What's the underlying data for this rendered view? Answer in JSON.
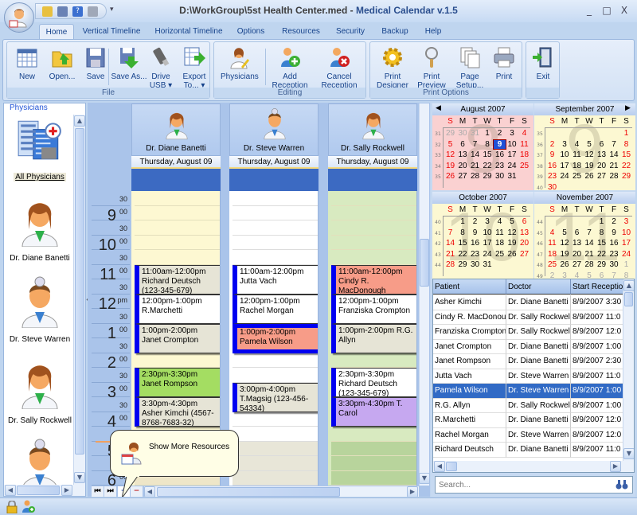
{
  "window": {
    "title_path": "D:\\WorkGroup\\5st Health Center.med",
    "title_sep": " - ",
    "title_app": "Medical Calendar v.1.5",
    "minimize": "_",
    "maximize": "□",
    "close": "X"
  },
  "quick_access": [
    "open-icon",
    "save-icon",
    "help-icon",
    "print-icon"
  ],
  "tabs": [
    {
      "label": "Home",
      "active": true
    },
    {
      "label": "Vertical Timeline"
    },
    {
      "label": "Horizontal Timeline"
    },
    {
      "label": "Options"
    },
    {
      "label": "Resources"
    },
    {
      "label": "Security"
    },
    {
      "label": "Backup"
    },
    {
      "label": "Help"
    }
  ],
  "ribbon": {
    "groups": [
      {
        "label": "File",
        "buttons": [
          {
            "label": "New",
            "icon": "calendar-grid-icon"
          },
          {
            "label": "Open...",
            "icon": "folder-open-icon"
          },
          {
            "label": "Save",
            "icon": "floppy-icon"
          },
          {
            "label": "Save As...",
            "icon": "save-as-icon"
          },
          {
            "label": "Drive USB ▾",
            "icon": "usb-drive-icon"
          },
          {
            "label": "Export To... ▾",
            "icon": "export-icon"
          }
        ]
      },
      {
        "label": "Editing",
        "buttons": [
          {
            "label": "Physicians",
            "icon": "physician-icon"
          },
          {
            "label": "Add Reception",
            "icon": "add-reception-icon"
          },
          {
            "label": "Cancel Reception ▾",
            "icon": "cancel-reception-icon"
          }
        ]
      },
      {
        "label": "Print Options",
        "buttons": [
          {
            "label": "Print Designer",
            "icon": "gear-icon"
          },
          {
            "label": "Print Preview",
            "icon": "magnifier-icon"
          },
          {
            "label": "Page Setup...",
            "icon": "pages-icon"
          },
          {
            "label": "Print",
            "icon": "printer-icon"
          }
        ]
      },
      {
        "label": "",
        "buttons": [
          {
            "label": "Exit",
            "icon": "exit-door-icon"
          }
        ]
      }
    ]
  },
  "physicians_panel": {
    "title": "Physicians",
    "items": [
      {
        "label": "All Physicians",
        "icon": "hospital-icon"
      },
      {
        "label": "Dr. Diane Banetti",
        "icon": "female-doctor-icon"
      },
      {
        "label": "Dr. Steve Warren",
        "icon": "male-doctor-icon"
      },
      {
        "label": "Dr. Sally Rockwell",
        "icon": "female-doctor-icon"
      },
      {
        "label": "",
        "icon": "male-doctor-icon"
      }
    ]
  },
  "schedule": {
    "time_labels": [
      {
        "h": "",
        "m": "30"
      },
      {
        "h": "9",
        "m": "00"
      },
      {
        "h": "",
        "m": "30"
      },
      {
        "h": "10",
        "m": "00"
      },
      {
        "h": "",
        "m": "30"
      },
      {
        "h": "11",
        "m": "00"
      },
      {
        "h": "",
        "m": "30"
      },
      {
        "h": "12",
        "m": "pm"
      },
      {
        "h": "",
        "m": "30"
      },
      {
        "h": "1",
        "m": "00"
      },
      {
        "h": "",
        "m": "30"
      },
      {
        "h": "2",
        "m": "00"
      },
      {
        "h": "",
        "m": "30"
      },
      {
        "h": "3",
        "m": "00"
      },
      {
        "h": "",
        "m": "30"
      },
      {
        "h": "4",
        "m": "00"
      },
      {
        "h": "",
        "m": "30"
      },
      {
        "h": "5",
        "m": "00"
      },
      {
        "h": "",
        "m": "30"
      },
      {
        "h": "6",
        "m": "00"
      }
    ],
    "columns": [
      {
        "doctor": "Dr. Diane Banetti",
        "date": "Thursday, August 09",
        "appointments": [
          {
            "start": 11,
            "end": 12,
            "text": "11:00am-12:00pm Richard Deutsch (123-345-679)",
            "color": "#e6e4d6"
          },
          {
            "start": 12,
            "end": 13,
            "text": "12:00pm-1:00pm R.Marchetti",
            "color": "#ffffff"
          },
          {
            "start": 13,
            "end": 14,
            "text": "1:00pm-2:00pm Janet Crompton",
            "color": "#e6e4d6"
          },
          {
            "start": 14.5,
            "end": 15.5,
            "text": "2:30pm-3:30pm Janet Rompson",
            "color": "#a4dd62"
          },
          {
            "start": 15.5,
            "end": 16.5,
            "text": "3:30pm-4:30pm Asher Kimchi (4567-8768-7683-32)",
            "color": "#e6e4d6"
          }
        ]
      },
      {
        "doctor": "Dr. Steve Warren",
        "date": "Thursday, August 09",
        "appointments": [
          {
            "start": 11,
            "end": 12,
            "text": "11:00am-12:00pm Jutta Vach",
            "color": "#ffffff"
          },
          {
            "start": 12,
            "end": 13,
            "text": "12:00pm-1:00pm Rachel Morgan",
            "color": "#ffffff"
          },
          {
            "start": 13,
            "end": 14,
            "text": "1:00pm-2:00pm Pamela Wilson",
            "color": "#f79c88",
            "selected": true
          },
          {
            "start": 15,
            "end": 16,
            "text": "3:00pm-4:00pm T.Magsig (123-456-54334)",
            "color": "#e6e4d6"
          }
        ]
      },
      {
        "doctor": "Dr. Sally Rockwell",
        "date": "Thursday, August 09",
        "appointments": [
          {
            "start": 11,
            "end": 12,
            "text": "11:00am-12:00pm Cindy R. MacDonough",
            "color": "#f79c88"
          },
          {
            "start": 12,
            "end": 13,
            "text": "12:00pm-1:00pm Franziska Crompton",
            "color": "#ffffff"
          },
          {
            "start": 13,
            "end": 14,
            "text": "1:00pm-2:00pm R.G. Allyn",
            "color": "#e6e4d6"
          },
          {
            "start": 14.5,
            "end": 15.5,
            "text": "2:30pm-3:30pm Richard Deutsch (123-345-679)",
            "color": "#ffffff"
          },
          {
            "start": 15.5,
            "end": 16.5,
            "text": "3:30pm-4:30pm T. Carol",
            "color": "#c6a8f0"
          }
        ]
      }
    ],
    "tooltip": "Show More Resources",
    "nav": {
      "first": "⏮",
      "last": "⏭",
      "add": "+",
      "remove": "−"
    }
  },
  "mini_calendars": {
    "weekdays": [
      "S",
      "M",
      "T",
      "W",
      "T",
      "F",
      "S"
    ],
    "selected": {
      "month": 0,
      "day": "9"
    },
    "months": [
      {
        "title": "August 2007",
        "big": "8",
        "weeks": [
          {
            "n": "31",
            "days": [
              "29",
              "30",
              "31",
              "1",
              "2",
              "3",
              "4"
            ],
            "gray": [
              0,
              1,
              2
            ]
          },
          {
            "n": "32",
            "days": [
              "5",
              "6",
              "7",
              "8",
              "9",
              "10",
              "11"
            ]
          },
          {
            "n": "33",
            "days": [
              "12",
              "13",
              "14",
              "15",
              "16",
              "17",
              "18"
            ]
          },
          {
            "n": "34",
            "days": [
              "19",
              "20",
              "21",
              "22",
              "23",
              "24",
              "25"
            ]
          },
          {
            "n": "35",
            "days": [
              "26",
              "27",
              "28",
              "29",
              "30",
              "31",
              ""
            ]
          }
        ]
      },
      {
        "title": "September 2007",
        "big": "9",
        "weeks": [
          {
            "n": "35",
            "days": [
              "",
              "",
              "",
              "",
              "",
              "",
              "1"
            ]
          },
          {
            "n": "36",
            "days": [
              "2",
              "3",
              "4",
              "5",
              "6",
              "7",
              "8"
            ]
          },
          {
            "n": "37",
            "days": [
              "9",
              "10",
              "11",
              "12",
              "13",
              "14",
              "15"
            ]
          },
          {
            "n": "38",
            "days": [
              "16",
              "17",
              "18",
              "19",
              "20",
              "21",
              "22"
            ]
          },
          {
            "n": "39",
            "days": [
              "23",
              "24",
              "25",
              "26",
              "27",
              "28",
              "29"
            ]
          },
          {
            "n": "40",
            "days": [
              "30",
              "",
              "",
              "",
              "",
              "",
              ""
            ]
          }
        ]
      },
      {
        "title": "October 2007",
        "big": "10",
        "weeks": [
          {
            "n": "40",
            "days": [
              "",
              "1",
              "2",
              "3",
              "4",
              "5",
              "6"
            ]
          },
          {
            "n": "41",
            "days": [
              "7",
              "8",
              "9",
              "10",
              "11",
              "12",
              "13"
            ]
          },
          {
            "n": "42",
            "days": [
              "14",
              "15",
              "16",
              "17",
              "18",
              "19",
              "20"
            ]
          },
          {
            "n": "43",
            "days": [
              "21",
              "22",
              "23",
              "24",
              "25",
              "26",
              "27"
            ]
          },
          {
            "n": "44",
            "days": [
              "28",
              "29",
              "30",
              "31",
              "",
              "",
              ""
            ]
          }
        ]
      },
      {
        "title": "November 2007",
        "big": "11",
        "weeks": [
          {
            "n": "44",
            "days": [
              "",
              "",
              "",
              "",
              "1",
              "2",
              "3"
            ]
          },
          {
            "n": "45",
            "days": [
              "4",
              "5",
              "6",
              "7",
              "8",
              "9",
              "10"
            ]
          },
          {
            "n": "46",
            "days": [
              "11",
              "12",
              "13",
              "14",
              "15",
              "16",
              "17"
            ]
          },
          {
            "n": "47",
            "days": [
              "18",
              "19",
              "20",
              "21",
              "22",
              "23",
              "24"
            ]
          },
          {
            "n": "48",
            "days": [
              "25",
              "26",
              "27",
              "28",
              "29",
              "30",
              "1"
            ],
            "gray": [
              6
            ]
          },
          {
            "n": "49",
            "days": [
              "2",
              "3",
              "4",
              "5",
              "6",
              "7",
              "8"
            ],
            "gray": [
              0,
              1,
              2,
              3,
              4,
              5,
              6
            ]
          }
        ]
      }
    ]
  },
  "reception_table": {
    "columns": [
      "Patient",
      "Doctor",
      "Start Reception"
    ],
    "rows": [
      [
        "Asher Kimchi",
        "Dr. Diane Banetti",
        "8/9/2007 3:30"
      ],
      [
        "Cindy R. MacDonough",
        "Dr. Sally Rockwell",
        "8/9/2007 11:0"
      ],
      [
        "Franziska Crompton",
        "Dr. Sally Rockwell",
        "8/9/2007 12:0"
      ],
      [
        "Janet Crompton",
        "Dr. Diane Banetti",
        "8/9/2007 1:00"
      ],
      [
        "Janet Rompson",
        "Dr. Diane Banetti",
        "8/9/2007 2:30"
      ],
      [
        "Jutta Vach",
        "Dr. Steve Warren",
        "8/9/2007 11:0"
      ],
      [
        "Pamela Wilson",
        "Dr. Steve Warren",
        "8/9/2007 1:00"
      ],
      [
        "R.G. Allyn",
        "Dr. Sally Rockwell",
        "8/9/2007 1:00"
      ],
      [
        "R.Marchetti",
        "Dr. Diane Banetti",
        "8/9/2007 12:0"
      ],
      [
        "Rachel Morgan",
        "Dr. Steve Warren",
        "8/9/2007 12:0"
      ],
      [
        "Richard Deutsch",
        "Dr. Diane Banetti",
        "8/9/2007 11:0"
      ]
    ],
    "selected_row": 6
  },
  "search": {
    "placeholder": "Search...",
    "value": ""
  },
  "statusbar": {
    "icons": [
      "lock-icon",
      "user-add-icon"
    ]
  }
}
